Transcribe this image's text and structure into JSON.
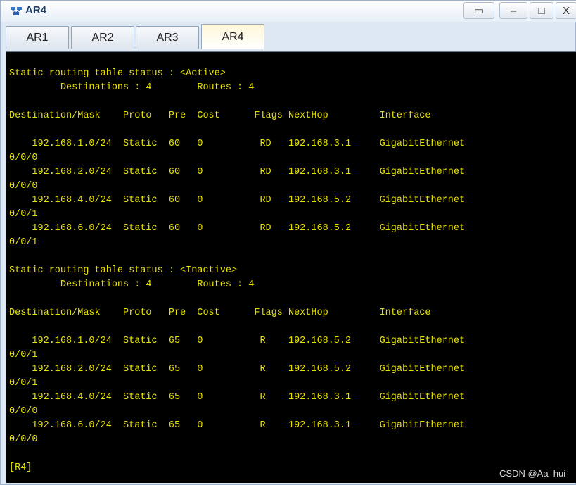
{
  "window": {
    "title": "AR4"
  },
  "window_buttons": {
    "restore": "▭",
    "minimize": "–",
    "maximize": "□",
    "close": "X"
  },
  "tabs": [
    {
      "label": "AR1",
      "active": false
    },
    {
      "label": "AR2",
      "active": false
    },
    {
      "label": "AR3",
      "active": false
    },
    {
      "label": "AR4",
      "active": true
    }
  ],
  "terminal": {
    "lines": [
      "Static routing table status : <Active>",
      "         Destinations : 4        Routes : 4",
      "",
      "Destination/Mask    Proto   Pre  Cost      Flags NextHop         Interface",
      "",
      "    192.168.1.0/24  Static  60   0          RD   192.168.3.1     GigabitEthernet",
      "0/0/0",
      "    192.168.2.0/24  Static  60   0          RD   192.168.3.1     GigabitEthernet",
      "0/0/0",
      "    192.168.4.0/24  Static  60   0          RD   192.168.5.2     GigabitEthernet",
      "0/0/1",
      "    192.168.6.0/24  Static  60   0          RD   192.168.5.2     GigabitEthernet",
      "0/0/1",
      "",
      "Static routing table status : <Inactive>",
      "         Destinations : 4        Routes : 4",
      "",
      "Destination/Mask    Proto   Pre  Cost      Flags NextHop         Interface",
      "",
      "    192.168.1.0/24  Static  65   0          R    192.168.5.2     GigabitEthernet",
      "0/0/1",
      "    192.168.2.0/24  Static  65   0          R    192.168.5.2     GigabitEthernet",
      "0/0/1",
      "    192.168.4.0/24  Static  65   0          R    192.168.3.1     GigabitEthernet",
      "0/0/0",
      "    192.168.6.0/24  Static  65   0          R    192.168.3.1     GigabitEthernet",
      "0/0/0",
      "",
      "[R4]"
    ]
  },
  "watermark": "CSDN @Aa  hui",
  "colors": {
    "terminal_bg": "#000000",
    "terminal_text": "#e8e200",
    "window_frame": "#dde8f3"
  },
  "icons": {
    "app": "network-router-icon"
  }
}
